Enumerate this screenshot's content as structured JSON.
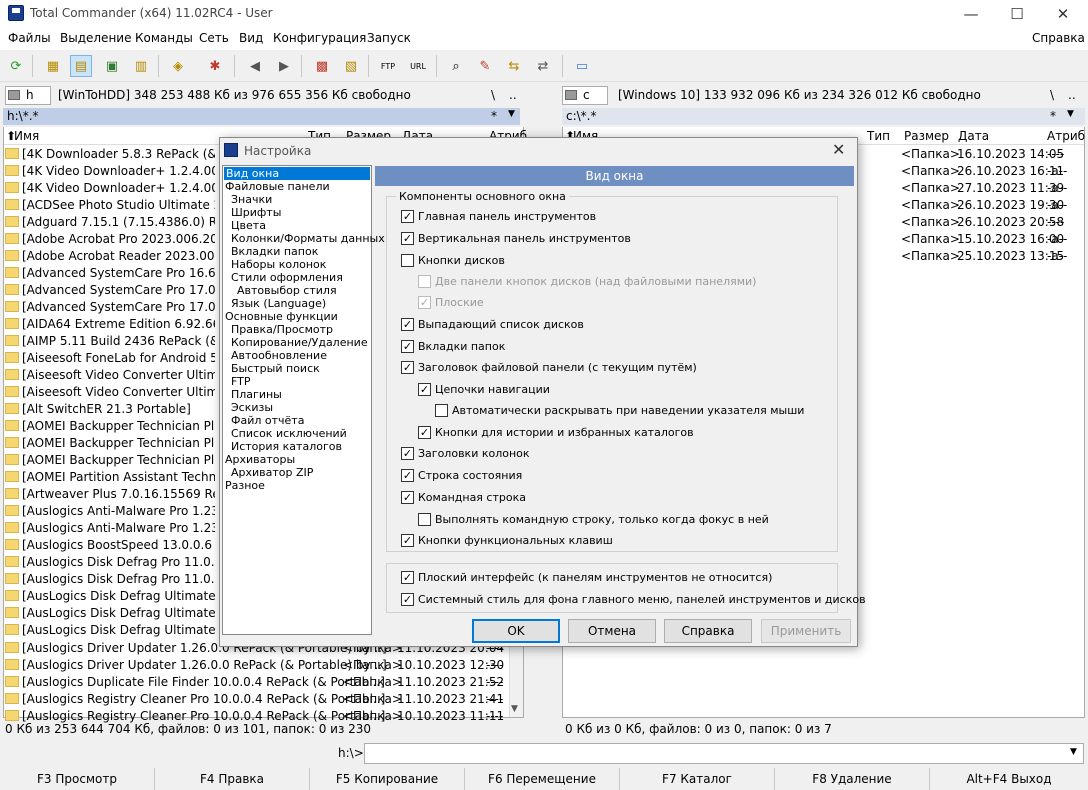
{
  "window": {
    "title": "Total Commander (x64) 11.02RC4 - User",
    "min": "—",
    "max": "☐",
    "close": "✕"
  },
  "menu": [
    "Файлы",
    "Выделение",
    "Команды",
    "Сеть",
    "Вид",
    "Конфигурация",
    "Запуск"
  ],
  "menu_help": "Справка",
  "left": {
    "drive": "h",
    "info": "[WinToHDD]  348 253 488 Кб из 976 655 356 Кб свободно",
    "path": "h:\\*.*",
    "root": "\\",
    "up": "..",
    "star": "*",
    "cols": {
      "name": "Имя",
      "type": "Тип",
      "size": "Размер",
      "date": "Дата",
      "attr": "Атриб"
    },
    "files": [
      "[4K Downloader 5.8.3 RePack (& Portable)",
      "[4K Video Downloader+ 1.2.4.0036 Re",
      "[4K Video Downloader+ 1.2.4.0036 Re",
      "[ACDSee Photo Studio Ultimate 2024",
      "[Adguard 7.15.1 (7.15.4386.0) RePack",
      "[Adobe Acrobat Pro 2023.006.20360 R",
      "[Adobe Acrobat Reader 2023.006.2036",
      "[Advanced SystemCare Pro 16.6.0.259",
      "[Advanced SystemCare Pro 17.0.1.107",
      "[Advanced SystemCare Pro 17.0.1.108",
      "[AIDA64 Extreme Edition 6.92.6618 Be",
      "[AIMP 5.11 Build 2436 RePack (& Port",
      "[Aiseesoft FoneLab for Android 5.0.26",
      "[Aiseesoft Video Converter Ultimate 1",
      "[Aiseesoft Video Converter Ultimate 1",
      "[Alt SwitchER 21.3 Portable]",
      "[AOMEI Backupper Technician Plus 7.",
      "[AOMEI Backupper Technician Plus 7.",
      "[AOMEI Backupper Technician Plus 7.",
      "[AOMEI Partition Assistant Technician",
      "[Artweaver Plus 7.0.16.15569 RePack (",
      "[Auslogics Anti-Malware Pro 1.23.0.0",
      "[Auslogics Anti-Malware Pro 1.23.0.0",
      "[Auslogics BoostSpeed 13.0.0.6 RePac",
      "[Auslogics Disk Defrag Pro 11.0.0.4 Re",
      "[Auslogics Disk Defrag Pro 11.0.0.4 Re",
      "[AusLogics Disk Defrag Ultimate 4.13.",
      "[AusLogics Disk Defrag Ultimate 4.13.",
      "[AusLogics Disk Defrag Ultimate 4.13."
    ],
    "files_full": [
      {
        "name": "[Auslogics Driver Updater 1.26.0.0 RePack (& Portable) by ..]",
        "type": "<Папка>",
        "date": "11.10.2023 20:04",
        "attr": "----"
      },
      {
        "name": "[Auslogics Driver Updater 1.26.0.0 RePack (& Portable) by ..]",
        "type": "<Папка>",
        "date": "10.10.2023 12:30",
        "attr": "----"
      },
      {
        "name": "[Auslogics Duplicate File Finder 10.0.0.4 RePack (& Portabl..]",
        "type": "<Папка>",
        "date": "11.10.2023 21:52",
        "attr": "----"
      },
      {
        "name": "[Auslogics Registry Cleaner Pro 10.0.0.4 RePack (& Portabl..]",
        "type": "<Папка>",
        "date": "11.10.2023 21:41",
        "attr": "----"
      },
      {
        "name": "[Auslogics Registry Cleaner Pro 10.0.0.4 RePack (& Portabl..]",
        "type": "<Папка>",
        "date": "10.10.2023 11:11",
        "attr": "----"
      }
    ],
    "status": "0 Кб из 253 644 704 Кб, файлов: 0 из 101, папок: 0 из 230"
  },
  "right": {
    "drive": "c",
    "info": "[Windows 10]  133 932 096 Кб из 234 326 012 Кб свободно",
    "path": "c:\\*.*",
    "root": "\\",
    "up": "..",
    "star": "*",
    "cols": {
      "name": "Имя",
      "type": "Тип",
      "size": "Размер",
      "date": "Дата",
      "attr": "Атриб"
    },
    "rows": [
      {
        "size": "<Папка>",
        "date": "16.10.2023 14:05",
        "attr": "----"
      },
      {
        "size": "<Папка>",
        "date": "26.10.2023 16:11",
        "attr": "-a--"
      },
      {
        "size": "<Папка>",
        "date": "27.10.2023 11:39",
        "attr": "-a--"
      },
      {
        "size": "<Папка>",
        "date": "26.10.2023 19:30",
        "attr": "-a--"
      },
      {
        "size": "<Папка>",
        "date": "26.10.2023 20:58",
        "attr": "----"
      },
      {
        "size": "<Папка>",
        "date": "15.10.2023 16:00",
        "attr": "-a--"
      },
      {
        "size": "<Папка>",
        "date": "25.10.2023 13:15",
        "attr": "-a--"
      }
    ],
    "status": "0 Кб из 0 Кб, файлов: 0 из 0, папок: 0 из 7"
  },
  "cmd": {
    "label": "h:\\>"
  },
  "fkeys": [
    "F3 Просмотр",
    "F4 Правка",
    "F5 Копирование",
    "F6 Перемещение",
    "F7 Каталог",
    "F8 Удаление",
    "Alt+F4 Выход"
  ],
  "dialog": {
    "title": "Настройка",
    "tree": [
      "Вид окна",
      "Файловые панели",
      "Значки",
      "Шрифты",
      "Цвета",
      "Колонки/Форматы данных",
      "Вкладки папок",
      "Наборы колонок",
      "Стили оформления",
      "Автовыбор стиля",
      "Язык (Language)",
      "Основные функции",
      "Правка/Просмотр",
      "Копирование/Удаление",
      "Автообновление",
      "Быстрый поиск",
      "FTP",
      "Плагины",
      "Эскизы",
      "Файл отчёта",
      "Список исключений",
      "История каталогов",
      "Архиваторы",
      "Архиватор ZIP",
      "Разное"
    ],
    "section": "Вид окна",
    "group_title": "Компоненты основного окна",
    "options": [
      {
        "label": "Главная панель инструментов",
        "checked": "✓"
      },
      {
        "label": "Вертикальная панель инструментов",
        "checked": "✓"
      },
      {
        "label": "Кнопки дисков",
        "checked": ""
      },
      {
        "label": "Две панели кнопок дисков (над файловыми панелями)",
        "checked": ""
      },
      {
        "label": "Плоские",
        "checked": "✓"
      },
      {
        "label": "Выпадающий список дисков",
        "checked": "✓"
      },
      {
        "label": "Вкладки папок",
        "checked": "✓"
      },
      {
        "label": "Заголовок файловой панели (с текущим путём)",
        "checked": "✓"
      },
      {
        "label": "Цепочки навигации",
        "checked": "✓"
      },
      {
        "label": "Автоматически раскрывать при наведении указателя мыши",
        "checked": ""
      },
      {
        "label": "Кнопки для истории и избранных каталогов",
        "checked": "✓"
      },
      {
        "label": "Заголовки колонок",
        "checked": "✓"
      },
      {
        "label": "Строка состояния",
        "checked": "✓"
      },
      {
        "label": "Командная строка",
        "checked": "✓"
      },
      {
        "label": "Выполнять командную строку, только когда фокус в ней",
        "checked": ""
      },
      {
        "label": "Кнопки функциональных клавиш",
        "checked": "✓"
      }
    ],
    "options2": [
      {
        "label": "Плоский интерфейс (к панелям инструментов не относится)",
        "checked": "✓"
      },
      {
        "label": "Системный стиль для фона главного меню, панелей инструментов и дисков",
        "checked": "✓"
      }
    ],
    "buttons": {
      "ok": "OK",
      "cancel": "Отмена",
      "help": "Справка",
      "apply": "Применить"
    }
  }
}
